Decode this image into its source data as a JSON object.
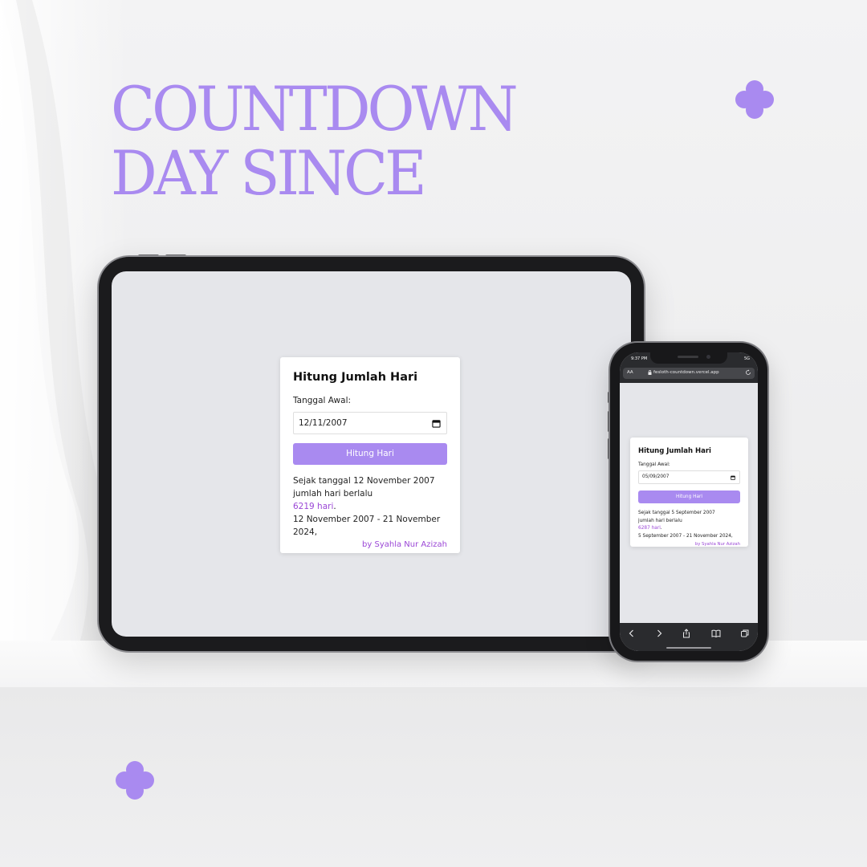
{
  "headline": {
    "line1": "COUNTDOWN",
    "line2": "DAY SINCE"
  },
  "colors": {
    "accent": "#a98af0",
    "highlight": "#9b47d6",
    "device": "#1b1b1d",
    "screen": "#e5e6ea"
  },
  "icons": {
    "decor": "clover-icon",
    "calendar": "calendar-icon"
  },
  "tablet": {
    "card": {
      "title": "Hitung Jumlah Hari",
      "label": "Tanggal Awal:",
      "date_value": "12/11/2007",
      "button": "Hitung Hari",
      "line1": "Sejak tanggal 12 November 2007",
      "line2": "jumlah hari berlalu",
      "days": "6219 hari",
      "days_suffix": ".",
      "range": "12 November 2007 - 21 November 2024,",
      "byline": "by Syahla Nur Azizah"
    }
  },
  "phone": {
    "status": {
      "time": "9:37 PM",
      "signal": "5G"
    },
    "browser": {
      "aa": "AA",
      "url": "fesloth-countdown.vercel.app",
      "nav": [
        "back-icon",
        "forward-icon",
        "share-icon",
        "bookmarks-icon",
        "tabs-icon"
      ]
    },
    "card": {
      "title": "Hitung Jumlah Hari",
      "label": "Tanggal Awal:",
      "date_value": "05/09/2007",
      "button": "Hitung Hari",
      "line1": "Sejak tanggal 5 September 2007",
      "line2": "jumlah hari berlalu",
      "days": "6287 hari",
      "days_suffix": ".",
      "range": "5 September 2007 - 21 November 2024,",
      "byline": "by Syahla Nur Azizah"
    }
  }
}
